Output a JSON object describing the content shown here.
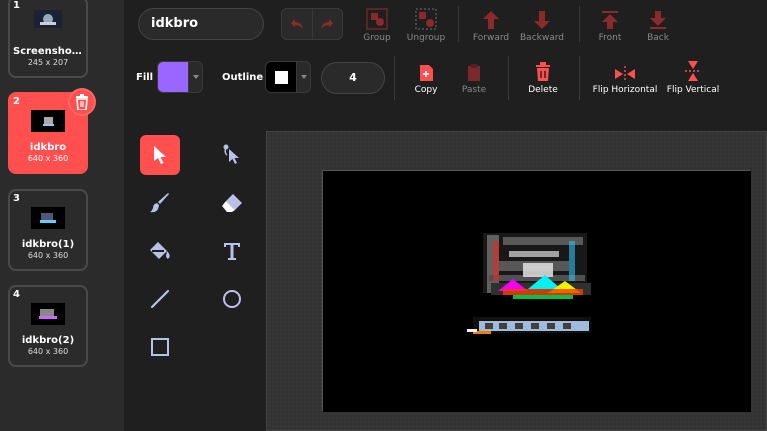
{
  "costumes": [
    {
      "num": "1",
      "name": "Screenshot ...",
      "size": "245 x 207"
    },
    {
      "num": "2",
      "name": "idkbro",
      "size": "640 x 360"
    },
    {
      "num": "3",
      "name": "idkbro(1)",
      "size": "640 x 360"
    },
    {
      "num": "4",
      "name": "idkbro(2)",
      "size": "640 x 360"
    }
  ],
  "selected_costume": "2",
  "costume_name_value": "idkbro",
  "toolbar": {
    "group": "Group",
    "ungroup": "Ungroup",
    "forward": "Forward",
    "backward": "Backward",
    "front": "Front",
    "back": "Back",
    "fill_label": "Fill",
    "outline_label": "Outline",
    "stroke_width": "4",
    "copy": "Copy",
    "paste": "Paste",
    "delete": "Delete",
    "flip_horizontal": "Flip Horizontal",
    "flip_vertical": "Flip Vertical"
  },
  "colors": {
    "fill": "#9966ff",
    "outline": "#ffffff",
    "accent": "#ff4f4f"
  },
  "tools": [
    "select-icon",
    "reshape-icon",
    "brush-icon",
    "eraser-icon",
    "fill-bucket-icon",
    "text-icon",
    "line-icon",
    "circle-icon",
    "rectangle-icon"
  ]
}
